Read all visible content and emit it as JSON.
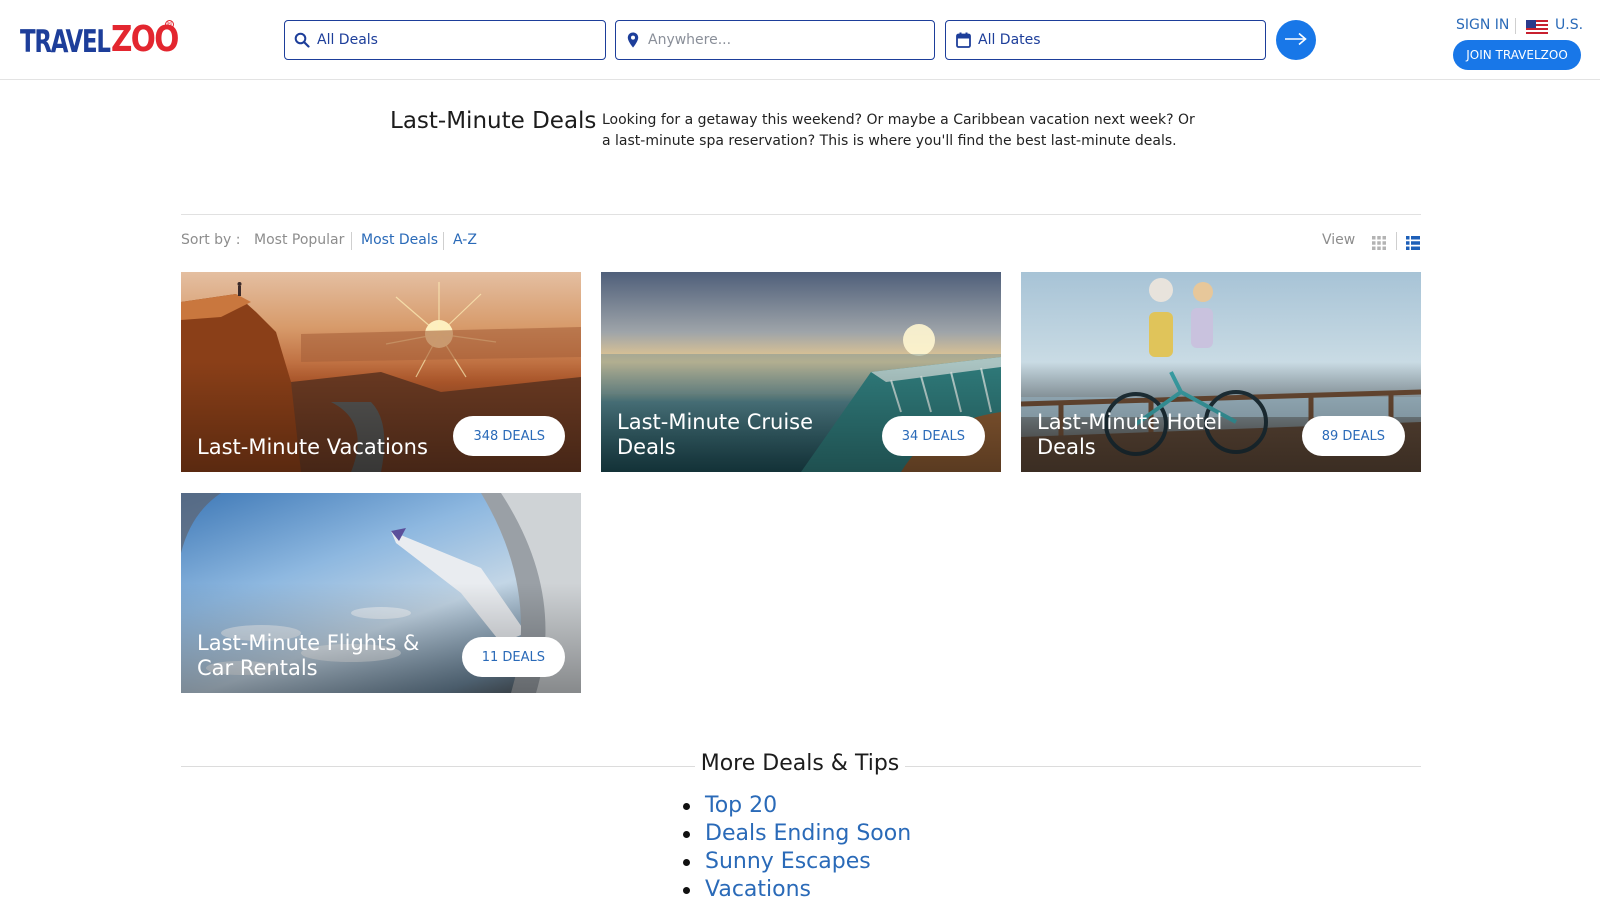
{
  "brand": {
    "logo_part1": "TRAVEL",
    "logo_part2": "ZOO",
    "logo_mark": "®"
  },
  "search": {
    "deals_value": "All Deals",
    "where_placeholder": "Anywhere...",
    "dates_value": "All Dates"
  },
  "account": {
    "sign_in": "SIGN IN",
    "region": "U.S.",
    "join": "JOIN TRAVELZOO"
  },
  "intro": {
    "title": "Last-Minute Deals",
    "text": "Looking for a getaway this weekend? Or maybe a Caribbean vacation next week? Or a last-minute spa reservation? This is where you'll find the best last-minute deals."
  },
  "sort": {
    "label": "Sort by :",
    "options": [
      "Most Popular",
      "Most Deals",
      "A-Z"
    ],
    "view_label": "View"
  },
  "cards": [
    {
      "title": "Last-Minute Vacations",
      "count": "348 DEALS"
    },
    {
      "title": "Last-Minute Cruise Deals",
      "count": "34 DEALS"
    },
    {
      "title": "Last-Minute Hotel Deals",
      "count": "89 DEALS"
    },
    {
      "title": "Last-Minute Flights & Car Rentals",
      "count": "11 DEALS"
    }
  ],
  "more": {
    "title": "More Deals & Tips",
    "links": [
      "Top 20",
      "Deals Ending Soon",
      "Sunny Escapes",
      "Vacations"
    ]
  },
  "colors": {
    "brand_blue": "#1d3e9a",
    "brand_red": "#e3262f",
    "accent": "#1877e8",
    "link": "#2a6ab8"
  }
}
